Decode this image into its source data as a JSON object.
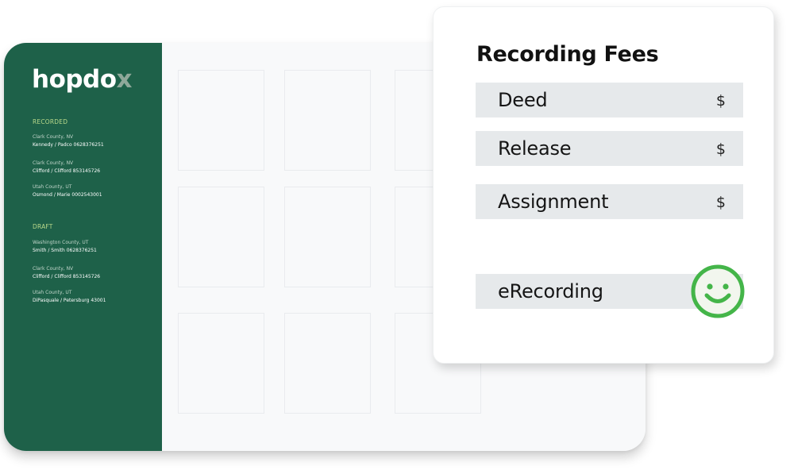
{
  "sidebar": {
    "logo_main": "hopdo",
    "logo_accent": "x",
    "sections": [
      {
        "label": "RECORDED",
        "items": [
          {
            "county": "Clark County, NV",
            "name": "Kennedy / Padco 0628376251"
          },
          {
            "county": "Clark County, NV",
            "name": "Clifford / Clifford 853145726"
          },
          {
            "county": "Utah County, UT",
            "name": "Osmond / Marie 0002543001"
          }
        ]
      },
      {
        "label": "DRAFT",
        "items": [
          {
            "county": "Washington County, UT",
            "name": "Smith / Smith 0628376251"
          },
          {
            "county": "Clark County, NV",
            "name": "Clifford / Clifford 853145726"
          },
          {
            "county": "Utah County, UT",
            "name": "DiPasquale / Petersburg 43001"
          }
        ]
      }
    ]
  },
  "fees_card": {
    "title": "Recording Fees",
    "rows": [
      {
        "label": "Deed",
        "currency": "$"
      },
      {
        "label": "Release",
        "currency": "$"
      },
      {
        "label": "Assignment",
        "currency": "$"
      }
    ],
    "erecording": {
      "label": "eRecording",
      "status_icon": "smiley-icon"
    }
  },
  "colors": {
    "brand_green": "#1e6149",
    "section_label": "#b8d88a",
    "smiley_green": "#44b549",
    "row_bg": "#e6e9eb"
  }
}
